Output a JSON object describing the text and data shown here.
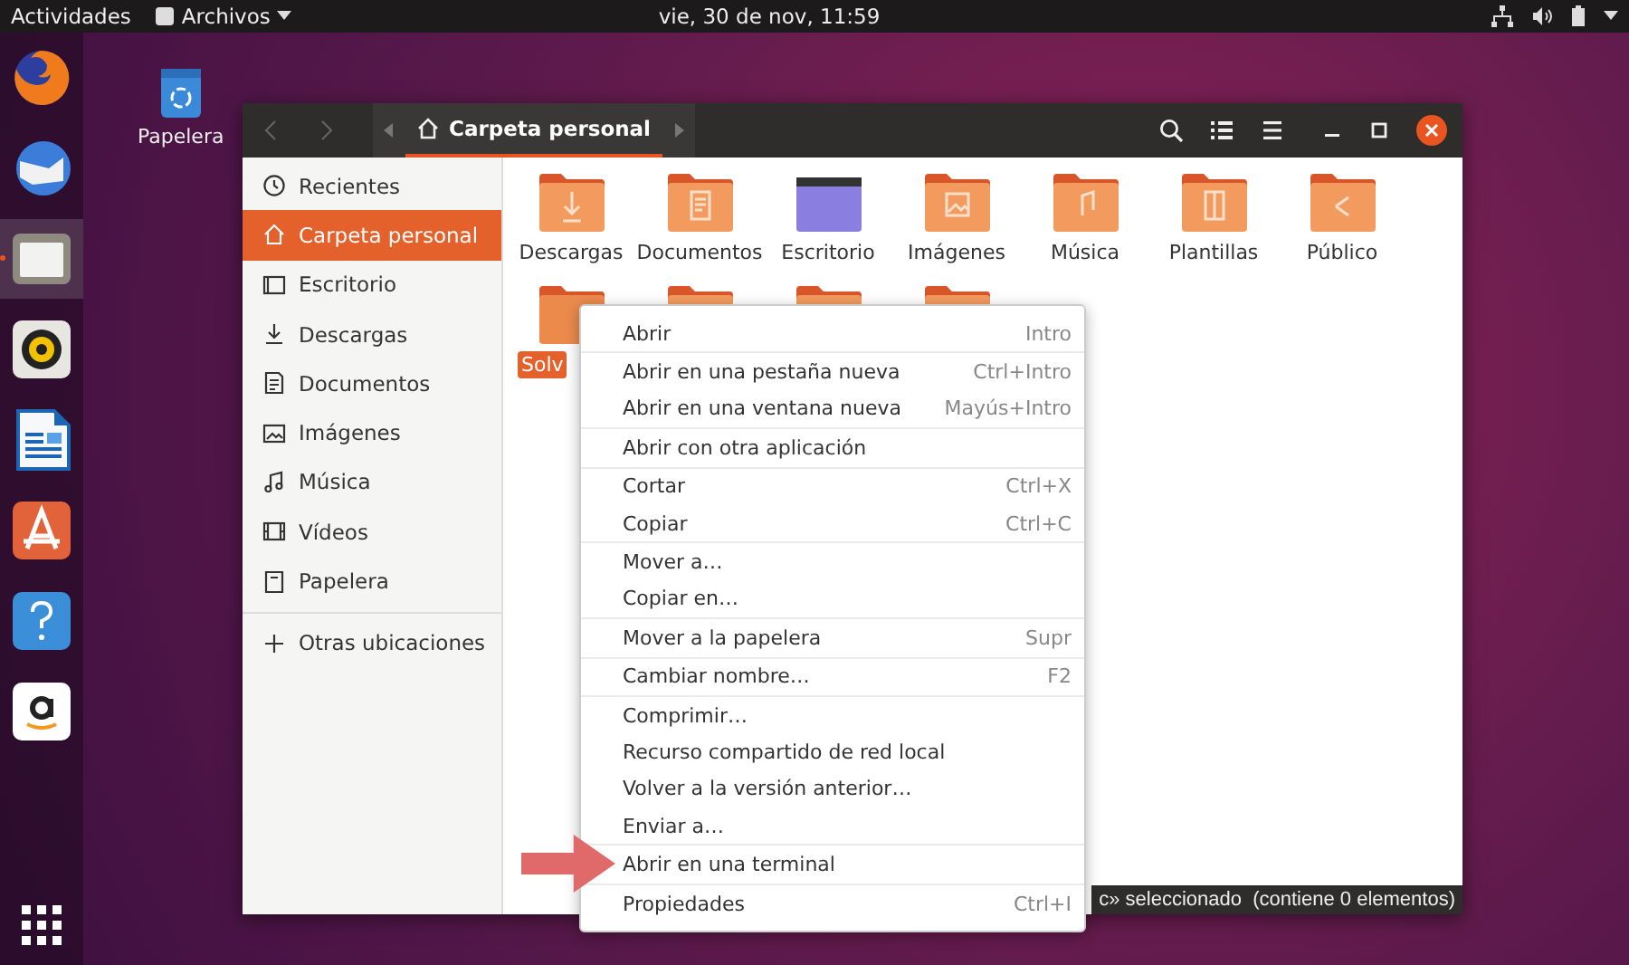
{
  "top_bar": {
    "activities": "Actividades",
    "app_menu": "Archivos",
    "clock": "vie, 30 de nov, 11:59"
  },
  "dock": [
    {
      "kind": "firefox",
      "active": false
    },
    {
      "kind": "mail",
      "active": false
    },
    {
      "kind": "files",
      "active": true
    },
    {
      "kind": "music",
      "active": false
    },
    {
      "kind": "writer",
      "active": false
    },
    {
      "kind": "store",
      "active": false
    },
    {
      "kind": "help",
      "active": false
    },
    {
      "kind": "amazon",
      "active": false
    }
  ],
  "desktop_icons": [
    {
      "label": "Papelera"
    }
  ],
  "window": {
    "path": "Carpeta personal",
    "sidebar": [
      {
        "label": "Recientes",
        "kind": "recent",
        "selected": false
      },
      {
        "label": "Carpeta personal",
        "kind": "home",
        "selected": true
      },
      {
        "label": "Escritorio",
        "kind": "desktop",
        "selected": false
      },
      {
        "label": "Descargas",
        "kind": "download",
        "selected": false
      },
      {
        "label": "Documentos",
        "kind": "document",
        "selected": false
      },
      {
        "label": "Imágenes",
        "kind": "image",
        "selected": false
      },
      {
        "label": "Música",
        "kind": "music",
        "selected": false
      },
      {
        "label": "Vídeos",
        "kind": "video",
        "selected": false
      },
      {
        "label": "Papelera",
        "kind": "trash",
        "selected": false
      }
    ],
    "other_locations": {
      "label": "Otras ubicaciones",
      "kind": "plus"
    },
    "files": [
      {
        "name": "Descargas",
        "kind": "download",
        "selected": false
      },
      {
        "name": "Documentos",
        "kind": "document",
        "selected": false
      },
      {
        "name": "Escritorio",
        "kind": "desktop",
        "selected": false
      },
      {
        "name": "Imágenes",
        "kind": "image",
        "selected": false
      },
      {
        "name": "Música",
        "kind": "music",
        "selected": false
      },
      {
        "name": "Plantillas",
        "kind": "template",
        "selected": false
      },
      {
        "name": "Público",
        "kind": "share",
        "selected": false
      },
      {
        "name": "Solv",
        "kind": "plain",
        "selected": true
      },
      {
        "kind": "plain",
        "selected": false
      },
      {
        "kind": "plain",
        "selected": false
      },
      {
        "kind": "plain",
        "selected": false
      }
    ],
    "status": "c» seleccionado  (contiene 0 elementos)"
  },
  "context_menu": {
    "sections": [
      [
        {
          "label": "Abrir",
          "shortcut": "Intro"
        }
      ],
      [
        {
          "label": "Abrir en una pestaña nueva",
          "shortcut": "Ctrl+Intro"
        },
        {
          "label": "Abrir en una ventana nueva",
          "shortcut": "Mayús+Intro"
        }
      ],
      [
        {
          "label": "Abrir con otra aplicación"
        }
      ],
      [
        {
          "label": "Cortar",
          "shortcut": "Ctrl+X"
        },
        {
          "label": "Copiar",
          "shortcut": "Ctrl+C"
        }
      ],
      [
        {
          "label": "Mover a…"
        },
        {
          "label": "Copiar en…"
        }
      ],
      [
        {
          "label": "Mover a la papelera",
          "shortcut": "Supr"
        }
      ],
      [
        {
          "label": "Cambiar nombre…",
          "shortcut": "F2"
        }
      ],
      [
        {
          "label": "Comprimir…"
        },
        {
          "label": "Recurso compartido de red local"
        },
        {
          "label": "Volver a la versión anterior…"
        },
        {
          "label": "Enviar a…"
        }
      ],
      [
        {
          "label": "Abrir en una terminal"
        }
      ],
      [
        {
          "label": "Propiedades",
          "shortcut": "Ctrl+I"
        }
      ]
    ]
  }
}
